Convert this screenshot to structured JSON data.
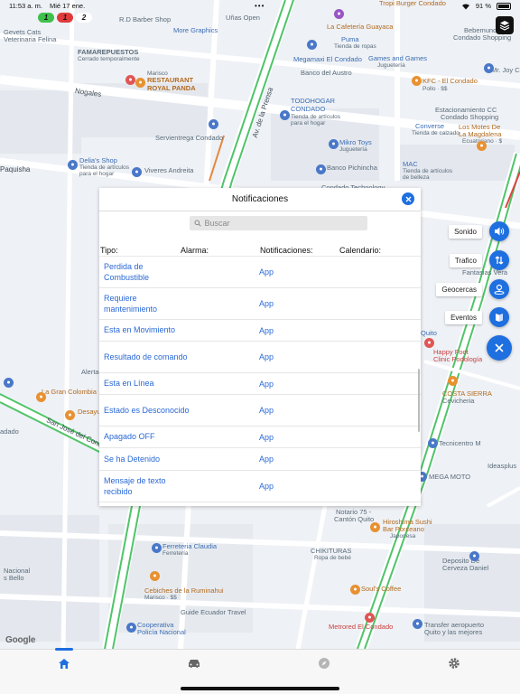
{
  "status_bar": {
    "time": "11:53 a. m.",
    "date": "Mié 17 ene.",
    "dots": "•••",
    "battery_text": "91 %"
  },
  "counters": [
    "1",
    "1",
    "2"
  ],
  "map": {
    "labels": [
      {
        "text": "Gevets Cats",
        "cls": ""
      },
      {
        "text": "Veterinaria Felina",
        "cls": ""
      },
      {
        "text": "FAMAREPUESTOS",
        "cls": ""
      },
      {
        "text": "Cerrado temporalmente",
        "cls": ""
      },
      {
        "text": "R.D Barber Shop",
        "cls": ""
      },
      {
        "text": "Uñas Open",
        "cls": ""
      },
      {
        "text": "More Graphics",
        "cls": "blue"
      },
      {
        "text": "RESTAURANT",
        "cls": "orange bold"
      },
      {
        "text": "ROYAL PANDA",
        "cls": "orange bold"
      },
      {
        "text": "Marisco",
        "cls": ""
      },
      {
        "text": "Nogales",
        "cls": "street"
      },
      {
        "text": "Servientrega Condado",
        "cls": ""
      },
      {
        "text": "Delia's Shop",
        "cls": "blue"
      },
      {
        "text": "Tienda de artículos",
        "cls": ""
      },
      {
        "text": "para el hogar",
        "cls": ""
      },
      {
        "text": "Paquisha",
        "cls": "street"
      },
      {
        "text": "Viveres Andreita",
        "cls": ""
      },
      {
        "text": "Av. de la Prensa",
        "cls": "street"
      },
      {
        "text": "Tropi Burger Condado",
        "cls": "orange"
      },
      {
        "text": "La Cafetería Guayaca",
        "cls": "orange"
      },
      {
        "text": "Puma",
        "cls": "blue"
      },
      {
        "text": "Tienda de ropas",
        "cls": ""
      },
      {
        "text": "Megamaxi El Condado",
        "cls": "blue"
      },
      {
        "text": "Games and Games",
        "cls": "blue"
      },
      {
        "text": "Juguetería",
        "cls": ""
      },
      {
        "text": "Banco del Austro",
        "cls": ""
      },
      {
        "text": "TODOHOGAR",
        "cls": "blue"
      },
      {
        "text": "CONDADO",
        "cls": "blue"
      },
      {
        "text": "Tienda de artículos",
        "cls": ""
      },
      {
        "text": "para el hogar",
        "cls": ""
      },
      {
        "text": "Mikro Toys",
        "cls": "blue"
      },
      {
        "text": "Juguetería",
        "cls": ""
      },
      {
        "text": "Banco Pichincha",
        "cls": ""
      },
      {
        "text": "Bebemundo",
        "cls": ""
      },
      {
        "text": "Condado Shopping",
        "cls": ""
      },
      {
        "text": "KFC - El Condado",
        "cls": "orange"
      },
      {
        "text": "Pollo · $$",
        "cls": ""
      },
      {
        "text": "Mr. Joy C",
        "cls": ""
      },
      {
        "text": "Estacionamiento CC",
        "cls": ""
      },
      {
        "text": "Condado Shopping",
        "cls": ""
      },
      {
        "text": "Converse",
        "cls": "blue"
      },
      {
        "text": "Tienda de calzado",
        "cls": ""
      },
      {
        "text": "Los Motes De",
        "cls": "orange"
      },
      {
        "text": "La Magdalena",
        "cls": "orange"
      },
      {
        "text": "Ecuatoriano · $",
        "cls": ""
      },
      {
        "text": "MAC",
        "cls": "blue"
      },
      {
        "text": "Tienda de artículos",
        "cls": ""
      },
      {
        "text": "de belleza",
        "cls": ""
      },
      {
        "text": "Alerta",
        "cls": ""
      },
      {
        "text": "La Gran Colombia",
        "cls": "orange"
      },
      {
        "text": "Desayu",
        "cls": "orange"
      },
      {
        "text": "adado",
        "cls": ""
      },
      {
        "text": "San José del Condado",
        "cls": "street"
      },
      {
        "text": "Quito",
        "cls": "blue"
      },
      {
        "text": "Happy Foot",
        "cls": "red"
      },
      {
        "text": "Clinic Podología",
        "cls": "red"
      },
      {
        "text": "COSTA SIERRA",
        "cls": "orange"
      },
      {
        "text": "Cevicheria",
        "cls": ""
      },
      {
        "text": "Tecnicentro M",
        "cls": ""
      },
      {
        "text": "Ideasplus",
        "cls": ""
      },
      {
        "text": "MEGA MOTO",
        "cls": ""
      },
      {
        "text": "Notario 75 -",
        "cls": ""
      },
      {
        "text": "Cantón Quito",
        "cls": ""
      },
      {
        "text": "Hiroshima Sushi",
        "cls": "orange"
      },
      {
        "text": "Bar Porceano",
        "cls": "orange"
      },
      {
        "text": "Japonesa",
        "cls": ""
      },
      {
        "text": "Ferreteria Claudia",
        "cls": "blue"
      },
      {
        "text": "Ferretería",
        "cls": ""
      },
      {
        "text": "CHIKITURAS",
        "cls": ""
      },
      {
        "text": "Ropa de bebé",
        "cls": ""
      },
      {
        "text": "Nacional",
        "cls": ""
      },
      {
        "text": "s Bello",
        "cls": ""
      },
      {
        "text": "Cebiches de la Ruminahui",
        "cls": "orange"
      },
      {
        "text": "Marisco · $$",
        "cls": ""
      },
      {
        "text": "Soul's Coffee",
        "cls": "orange"
      },
      {
        "text": "Deposito De",
        "cls": ""
      },
      {
        "text": "Cerveza Daniel",
        "cls": ""
      },
      {
        "text": "Guide Ecuador Travel",
        "cls": ""
      },
      {
        "text": "Cooperativa",
        "cls": "blue"
      },
      {
        "text": "Policía Nacional",
        "cls": "blue"
      },
      {
        "text": "Metrored El Condado",
        "cls": "red"
      },
      {
        "text": "Transfer aeropuerto",
        "cls": ""
      },
      {
        "text": "Quito y las mejores",
        "cls": ""
      },
      {
        "text": "Fantasias Vera",
        "cls": ""
      },
      {
        "text": "Condado Technology",
        "cls": ""
      }
    ]
  },
  "fabs": {
    "sonido": "Sonido",
    "trafico": "Trafico",
    "geocercas": "Geocercas",
    "eventos": "Eventos"
  },
  "google": "Google",
  "modal": {
    "title": "Notificaciones",
    "search_placeholder": "Buscar",
    "columns": [
      "Tipo:",
      "Alarma:",
      "Notificaciones:",
      "Calendario:"
    ],
    "rows": [
      {
        "type": "Perdida de Combustible",
        "notif": "App"
      },
      {
        "type": "Requiere mantenimiento",
        "notif": "App"
      },
      {
        "type": "Esta en Movimiento",
        "notif": "App"
      },
      {
        "type": "Resultado de comando",
        "notif": "App"
      },
      {
        "type": "Esta en Línea",
        "notif": "App"
      },
      {
        "type": "Estado es Desconocido",
        "notif": "App"
      },
      {
        "type": "Apagado OFF",
        "notif": "App"
      },
      {
        "type": "Se ha Detenido",
        "notif": "App"
      },
      {
        "type": "Mensaje de texto recibido",
        "notif": "App"
      }
    ]
  },
  "colors": {
    "accent": "#1e6fe0",
    "link": "#2a69d6"
  }
}
